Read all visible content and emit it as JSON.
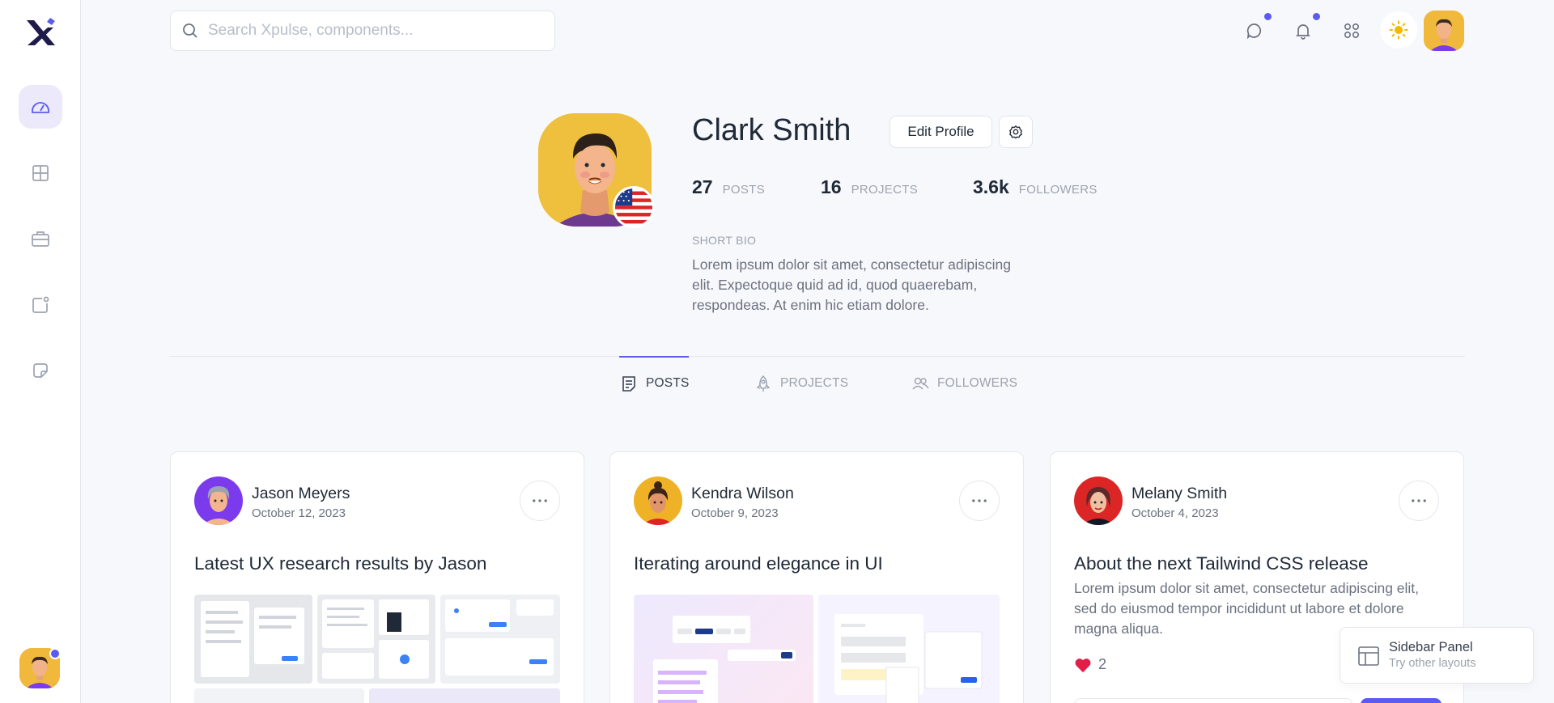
{
  "search": {
    "placeholder": "Search Xpulse, components..."
  },
  "profile": {
    "name": "Clark Smith",
    "edit_label": "Edit Profile",
    "stats": [
      {
        "value": "27",
        "label": "POSTS"
      },
      {
        "value": "16",
        "label": "PROJECTS"
      },
      {
        "value": "3.6k",
        "label": "FOLLOWERS"
      }
    ],
    "bio_label": "SHORT BIO",
    "bio": "Lorem ipsum dolor sit amet, consectetur adipiscing elit. Expectoque quid ad id, quod quaerebam, respondeas. At enim hic etiam dolore."
  },
  "tabs": [
    {
      "label": "POSTS",
      "icon": "document-icon",
      "active": true
    },
    {
      "label": "PROJECTS",
      "icon": "rocket-icon",
      "active": false
    },
    {
      "label": "FOLLOWERS",
      "icon": "users-icon",
      "active": false
    }
  ],
  "posts": [
    {
      "author": "Jason Meyers",
      "date": "October 12, 2023",
      "title": "Latest UX research results by Jason"
    },
    {
      "author": "Kendra Wilson",
      "date": "October 9, 2023",
      "title": "Iterating around elegance in UI"
    },
    {
      "author": "Melany Smith",
      "date": "October 4, 2023",
      "title": "About the next Tailwind CSS release",
      "text": "Lorem ipsum dolor sit amet, consectetur adipiscing elit, sed do eiusmod tempor incididunt ut labore et dolore magna aliqua.",
      "likes": "2"
    }
  ],
  "panel": {
    "title": "Sidebar Panel",
    "subtitle": "Try other layouts"
  },
  "colors": {
    "accent": "#5b5bf2",
    "background": "#f7f8fb",
    "heart": "#e11d48"
  }
}
